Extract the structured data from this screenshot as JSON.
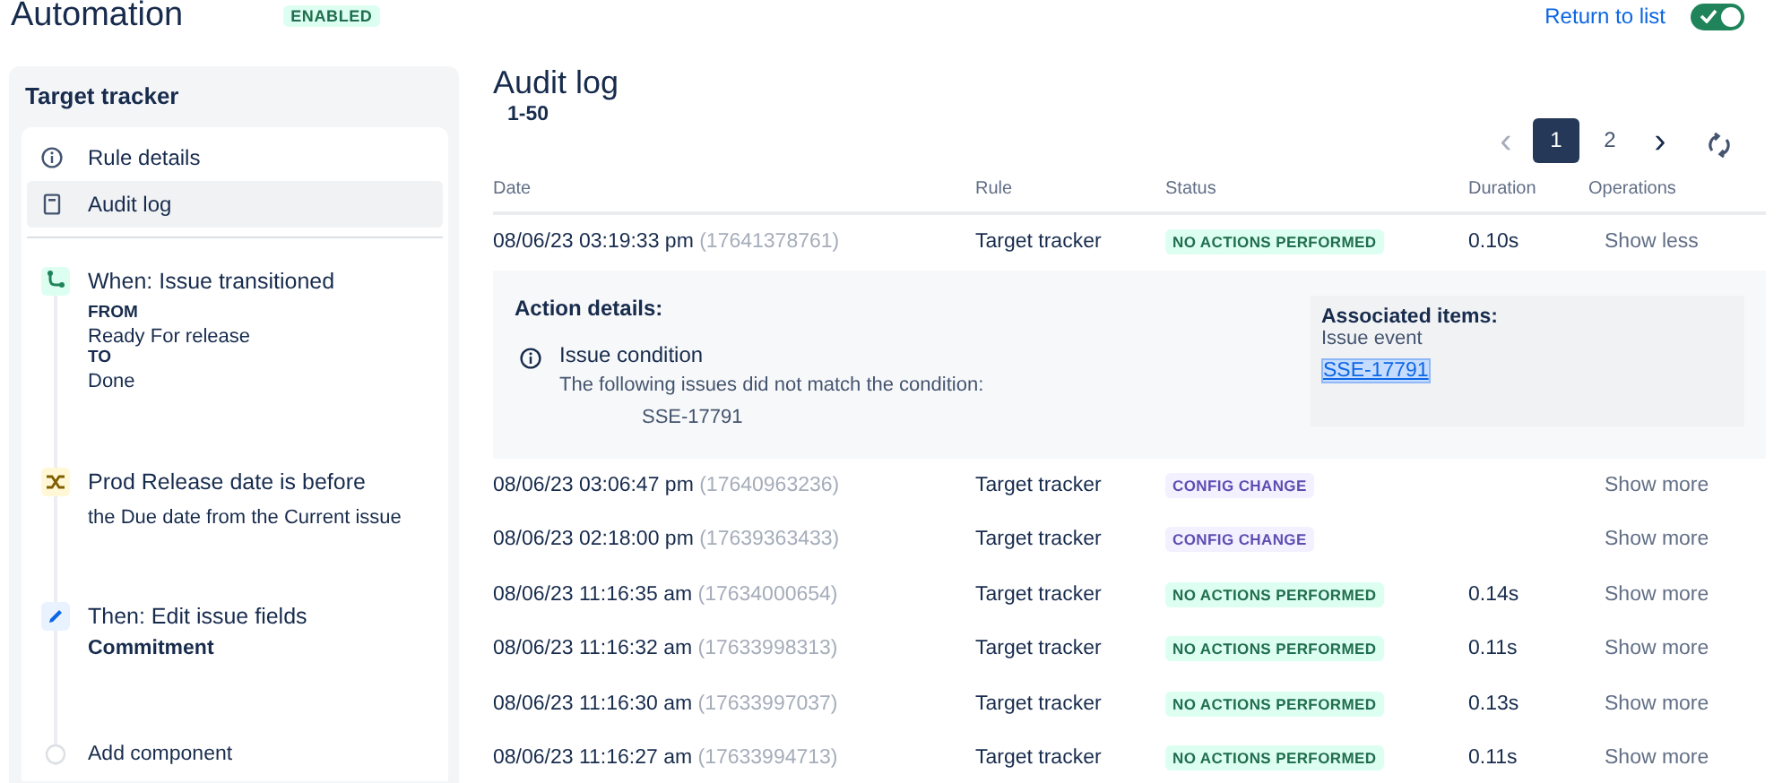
{
  "header": {
    "title": "Automation",
    "status_badge": "ENABLED",
    "return_link": "Return to list",
    "toggle": {
      "on": true
    }
  },
  "sidebar": {
    "title": "Target tracker",
    "nav": [
      {
        "label": "Rule details",
        "kind": "info",
        "selected": false
      },
      {
        "label": "Audit log",
        "kind": "log",
        "selected": true
      }
    ],
    "steps": [
      {
        "kind": "trigger",
        "title": "When: Issue transitioned",
        "lines": [
          {
            "text": "FROM",
            "bold": true
          },
          {
            "text": "Ready For release",
            "bold": false
          },
          {
            "text": "TO",
            "bold": true
          },
          {
            "text": "Done",
            "bold": false
          }
        ]
      },
      {
        "kind": "condition",
        "title": "Prod Release date is before",
        "lines": [
          {
            "text": "the Due date from the Current issue",
            "bold": false
          }
        ]
      },
      {
        "kind": "action",
        "title": "Then: Edit issue fields",
        "lines": [
          {
            "text": "Commitment",
            "bold": true
          }
        ]
      },
      {
        "kind": "add",
        "title": "Add component"
      }
    ]
  },
  "main": {
    "title": "Audit log",
    "range": "1-50",
    "pagination": {
      "prev": "‹",
      "next": "›",
      "pages": [
        {
          "label": "1",
          "selected": true
        },
        {
          "label": "2",
          "selected": false
        }
      ]
    },
    "table": {
      "columns": [
        "Date",
        "Rule",
        "Status",
        "Duration",
        "Operations"
      ],
      "rows": [
        {
          "date": "08/06/23 03:19:33 pm",
          "id": "(17641378761)",
          "rule": "Target tracker",
          "status": "NO ACTIONS PERFORMED",
          "kind": "success",
          "duration": "0.10s",
          "operation": "Show less",
          "details": {
            "title": "Action details:",
            "item_title": "Issue condition",
            "item_text": "The following issues did not match the condition:",
            "item_issue": "SSE-17791",
            "assoc_title": "Associated items:",
            "assoc_label": "Issue event",
            "assoc_link": "SSE-17791"
          }
        },
        {
          "date": "08/06/23 03:06:47 pm",
          "id": "(17640963236)",
          "rule": "Target tracker",
          "status": "CONFIG CHANGE",
          "kind": "config",
          "operation": "Show more"
        },
        {
          "date": "08/06/23 02:18:00 pm",
          "id": "(17639363433)",
          "rule": "Target tracker",
          "status": "CONFIG CHANGE",
          "kind": "config",
          "operation": "Show more"
        },
        {
          "date": "08/06/23 11:16:35 am",
          "id": "(17634000654)",
          "rule": "Target tracker",
          "status": "NO ACTIONS PERFORMED",
          "kind": "success",
          "duration": "0.14s",
          "operation": "Show more"
        },
        {
          "date": "08/06/23 11:16:32 am",
          "id": "(17633998313)",
          "rule": "Target tracker",
          "status": "NO ACTIONS PERFORMED",
          "kind": "success",
          "duration": "0.11s",
          "operation": "Show more"
        },
        {
          "date": "08/06/23 11:16:30 am",
          "id": "(17633997037)",
          "rule": "Target tracker",
          "status": "NO ACTIONS PERFORMED",
          "kind": "success",
          "duration": "0.13s",
          "operation": "Show more"
        },
        {
          "date": "08/06/23 11:16:27 am",
          "id": "(17633994713)",
          "rule": "Target tracker",
          "status": "NO ACTIONS PERFORMED",
          "kind": "success",
          "duration": "0.11s",
          "operation": "Show more"
        }
      ]
    }
  }
}
